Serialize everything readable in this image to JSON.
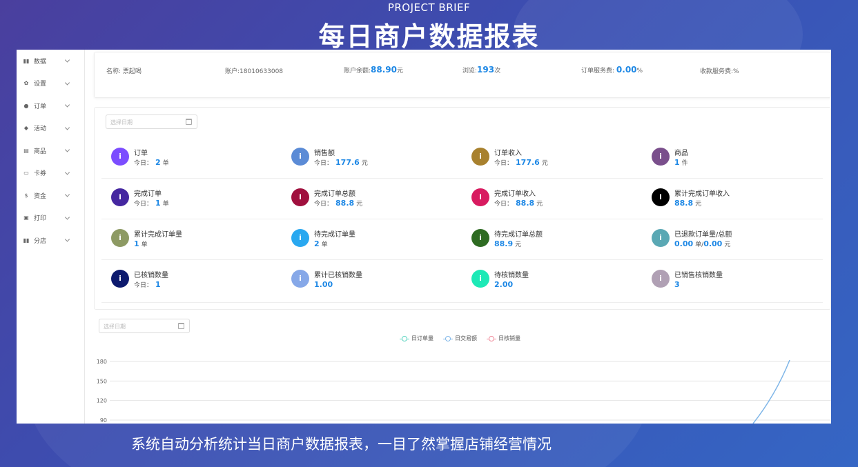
{
  "banner": {
    "subtitle": "PROJECT BRIEF",
    "title": "每日商户数据报表",
    "caption": "系统自动分析统计当日商户数据报表，一目了然掌握店铺经营情况"
  },
  "sidebar": {
    "items": [
      {
        "label": "数据",
        "icon": "bar-chart-icon"
      },
      {
        "label": "设置",
        "icon": "gear-icon"
      },
      {
        "label": "订单",
        "icon": "order-icon"
      },
      {
        "label": "活动",
        "icon": "tag-icon"
      },
      {
        "label": "商品",
        "icon": "goods-icon"
      },
      {
        "label": "卡券",
        "icon": "card-icon"
      },
      {
        "label": "资金",
        "icon": "dollar-icon"
      },
      {
        "label": "打印",
        "icon": "printer-icon"
      },
      {
        "label": "分店",
        "icon": "bar-chart-icon"
      }
    ]
  },
  "account": {
    "name_label": "名称:",
    "name_value": "票起喝",
    "account_label": "账户:",
    "account_value": "18010633008",
    "balance_label": "账户余额:",
    "balance_value": "88.90",
    "balance_unit": "元",
    "views_label": "浏览:",
    "views_value": "193",
    "views_unit": "次",
    "order_fee_label": "订单服务费:",
    "order_fee_value": "0.00",
    "order_fee_unit": "%",
    "collect_fee_label": "收款服务费:",
    "collect_fee_unit": "%"
  },
  "stats_date": {
    "placeholder": "选择日期"
  },
  "stats": [
    {
      "title": "订单",
      "prefix": "今日：",
      "value": "2",
      "value2": "",
      "unit": "单",
      "color": "#7c4dff"
    },
    {
      "title": "销售额",
      "prefix": "今日：",
      "value": "177.6",
      "value2": "",
      "unit": "元",
      "color": "#5b8bd6"
    },
    {
      "title": "订单收入",
      "prefix": "今日：",
      "value": "177.6",
      "value2": "",
      "unit": "元",
      "color": "#a8812e"
    },
    {
      "title": "商品",
      "prefix": "",
      "value": "1",
      "value2": "",
      "unit": "件",
      "color": "#7a4f8c"
    },
    {
      "title": "完成订单",
      "prefix": "今日：",
      "value": "1",
      "value2": "",
      "unit": "单",
      "color": "#4527a0"
    },
    {
      "title": "完成订单总额",
      "prefix": "今日：",
      "value": "88.8",
      "value2": "",
      "unit": "元",
      "color": "#a0103e"
    },
    {
      "title": "完成订单收入",
      "prefix": "今日：",
      "value": "88.8",
      "value2": "",
      "unit": "元",
      "color": "#d81b60"
    },
    {
      "title": "累计完成订单收入",
      "prefix": "",
      "value": "88.8",
      "value2": "",
      "unit": "元",
      "color": "#000000"
    },
    {
      "title": "累计完成订单量",
      "prefix": "",
      "value": "1",
      "value2": "",
      "unit": "单",
      "color": "#8d9a63"
    },
    {
      "title": "待完成订单量",
      "prefix": "",
      "value": "2",
      "value2": "",
      "unit": "单",
      "color": "#29a8f0"
    },
    {
      "title": "待完成订单总额",
      "prefix": "",
      "value": "88.9",
      "value2": "",
      "unit": "元",
      "color": "#2e6b22"
    },
    {
      "title": "已退款订单量/总额",
      "prefix": "",
      "value": "0.00",
      "value2": "0.00",
      "unit": "单/",
      "unit2": "元",
      "color": "#5aa8b4"
    },
    {
      "title": "已核销数量",
      "prefix": "今日：",
      "value": "1",
      "value2": "",
      "unit": "",
      "color": "#0d1a6e"
    },
    {
      "title": "累计已核销数量",
      "prefix": "",
      "value": "1.00",
      "value2": "",
      "unit": "",
      "color": "#86a8e8"
    },
    {
      "title": "待核销数量",
      "prefix": "",
      "value": "2.00",
      "value2": "",
      "unit": "",
      "color": "#1de9b6"
    },
    {
      "title": "已销售核销数量",
      "prefix": "",
      "value": "3",
      "value2": "",
      "unit": "",
      "color": "#b0a0b4"
    }
  ],
  "chart_date": {
    "placeholder": "选择日期"
  },
  "chart_data": {
    "type": "line",
    "series": [
      {
        "name": "日订单量",
        "color": "#5bd4c0"
      },
      {
        "name": "日交易额",
        "color": "#7fb6e8"
      },
      {
        "name": "日核销量",
        "color": "#f08a9a"
      }
    ],
    "yticks": [
      180,
      150,
      120,
      90
    ],
    "ylim": [
      90,
      180
    ]
  }
}
